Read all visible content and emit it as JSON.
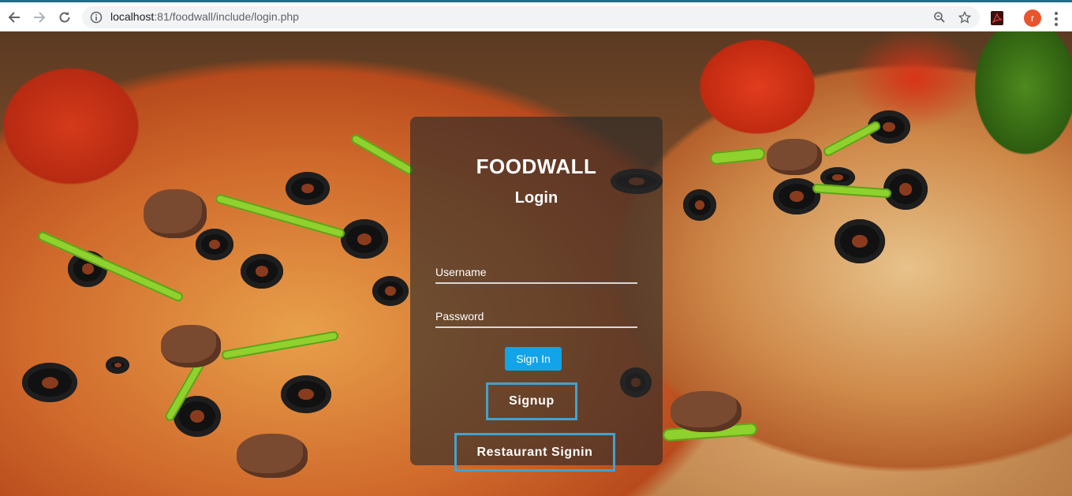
{
  "browser": {
    "url_host": "localhost",
    "url_path": ":81/foodwall/include/login.php",
    "avatar_letter": "r",
    "icons": [
      "back-icon",
      "forward-icon",
      "reload-icon",
      "info-icon",
      "zoom-icon",
      "star-icon",
      "pdf-extension-icon",
      "menu-icon"
    ]
  },
  "login": {
    "brand": "FOODWALL",
    "heading": "Login",
    "username_placeholder": "Username",
    "password_placeholder": "Password",
    "signin_label": "Sign In",
    "signup_label": "Signup",
    "restaurant_label": "Restaurant Signin"
  },
  "colors": {
    "primary_button": "#12a3e8",
    "outline_button_border": "#43a2cb",
    "card_overlay": "rgba(40,40,40,0.62)"
  }
}
